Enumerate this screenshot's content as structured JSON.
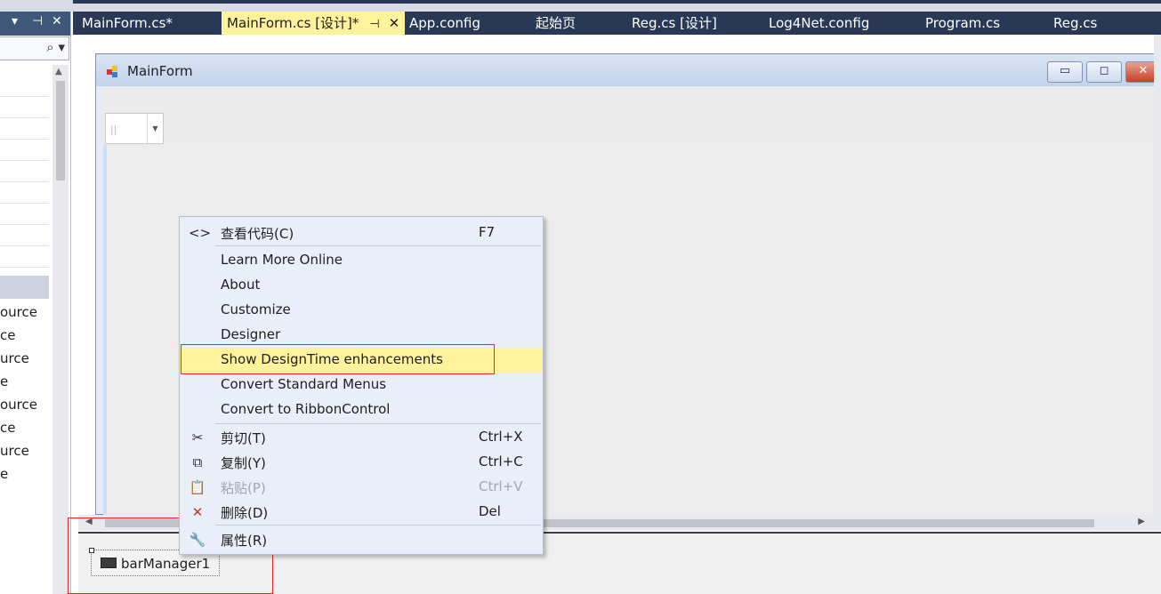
{
  "tabs": [
    {
      "label": "MainForm.cs*"
    },
    {
      "label": "MainForm.cs [设计]*",
      "active": true,
      "pin": "⊣",
      "close": "✕"
    },
    {
      "label": "App.config"
    },
    {
      "label": "起始页"
    },
    {
      "label": "Reg.cs [设计]"
    },
    {
      "label": "Log4Net.config"
    },
    {
      "label": "Program.cs"
    },
    {
      "label": "Reg.cs"
    }
  ],
  "left_panel": {
    "title_controls": [
      "▾",
      "⊣",
      "✕"
    ],
    "search_icon": "⌕ ▾",
    "items": [
      "ource",
      "ce",
      "urce",
      "e",
      "ource",
      "ce",
      "urce",
      "e"
    ]
  },
  "form": {
    "title": "MainForm",
    "min": "▭",
    "max": "◻",
    "close": "✕"
  },
  "context_menu": {
    "items": [
      {
        "icon": "<>",
        "label": "查看代码(C)",
        "shortcut": "F7"
      },
      {
        "label": "Learn More Online"
      },
      {
        "label": "About"
      },
      {
        "label": "Customize"
      },
      {
        "label": "Designer"
      },
      {
        "label": "Show DesignTime enhancements",
        "highlighted": true
      },
      {
        "label": "Convert Standard Menus"
      },
      {
        "label": "Convert to RibbonControl"
      },
      {
        "icon": "✂",
        "label": "剪切(T)",
        "shortcut": "Ctrl+X"
      },
      {
        "icon": "⧉",
        "label": "复制(Y)",
        "shortcut": "Ctrl+C"
      },
      {
        "icon": "📋",
        "label": "粘贴(P)",
        "shortcut": "Ctrl+V",
        "disabled": true
      },
      {
        "icon": "✕",
        "label": "删除(D)",
        "shortcut": "Del"
      },
      {
        "icon": "🔧",
        "label": "属性(R)"
      }
    ]
  },
  "tray": {
    "component": "barManager1"
  },
  "colors": {
    "tab_bar": "#293955",
    "active_tab": "#fff29d",
    "menu_bg": "#e9eef9",
    "highlight_box": "#e22222",
    "delete_icon": "#c0392b"
  }
}
